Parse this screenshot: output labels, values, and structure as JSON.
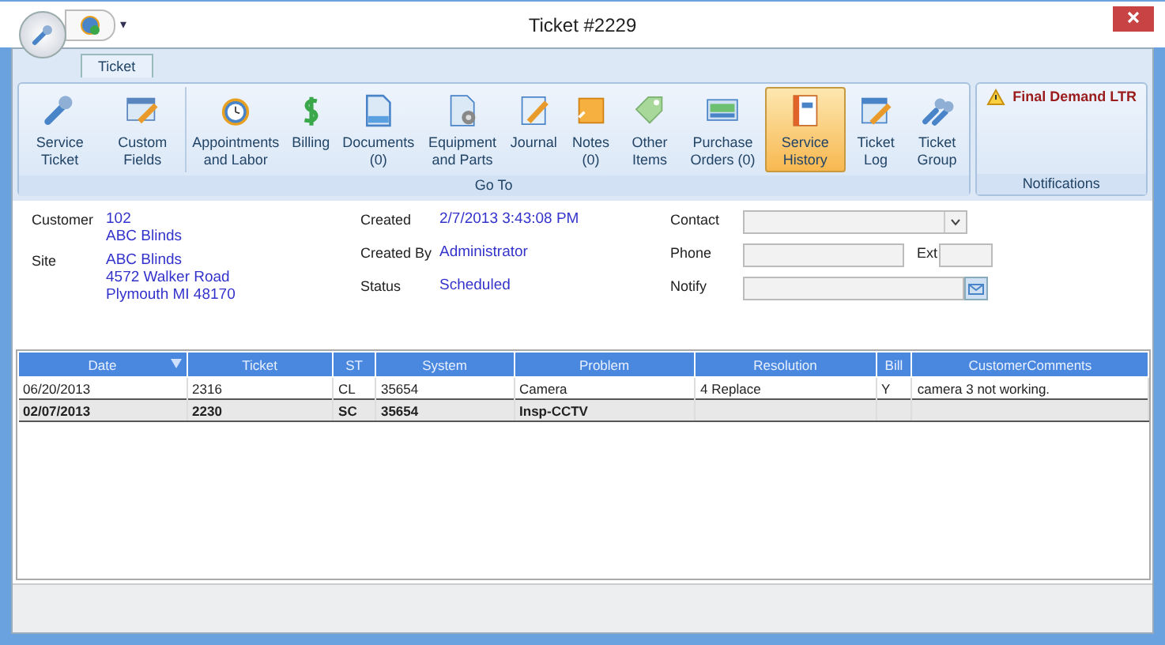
{
  "window": {
    "title": "Ticket #2229"
  },
  "quick_access": {
    "menu_glyph": "▾"
  },
  "tabs": [
    {
      "label": "Ticket",
      "selected": true
    }
  ],
  "ribbon": {
    "goto_group": {
      "label": "Go To",
      "sections": [
        [
          {
            "label": "Service Ticket",
            "selected": false
          },
          {
            "label": "Custom Fields",
            "selected": false
          }
        ],
        [
          {
            "label": "Appointments and Labor",
            "selected": false
          },
          {
            "label": "Billing",
            "selected": false
          },
          {
            "label": "Documents (0)",
            "selected": false
          },
          {
            "label": "Equipment and Parts",
            "selected": false
          },
          {
            "label": "Journal",
            "selected": false
          },
          {
            "label": "Notes (0)",
            "selected": false
          },
          {
            "label": "Other Items",
            "selected": false
          },
          {
            "label": "Purchase Orders (0)",
            "selected": false
          },
          {
            "label": "Service History",
            "selected": true
          },
          {
            "label": "Ticket Log",
            "selected": false
          },
          {
            "label": "Ticket Group",
            "selected": false
          }
        ]
      ]
    },
    "notifications": {
      "label": "Notifications",
      "items": [
        "Final Demand LTR"
      ]
    }
  },
  "details": {
    "customer": {
      "label": "Customer",
      "lines": [
        "102",
        "ABC Blinds"
      ]
    },
    "site": {
      "label": "Site",
      "lines": [
        "ABC Blinds",
        "4572 Walker Road",
        "Plymouth MI 48170"
      ]
    },
    "created": {
      "label": "Created",
      "value": "2/7/2013 3:43:08 PM"
    },
    "created_by": {
      "label": "Created By",
      "value": "Administrator"
    },
    "status": {
      "label": "Status",
      "value": "Scheduled"
    },
    "contact": {
      "label": "Contact"
    },
    "phone": {
      "label": "Phone"
    },
    "ext": {
      "label": "Ext"
    },
    "notify": {
      "label": "Notify"
    }
  },
  "table": {
    "columns": [
      "Date",
      "Ticket",
      "ST",
      "System",
      "Problem",
      "Resolution",
      "Bill",
      "CustomerComments"
    ],
    "rows": [
      {
        "selected": false,
        "cells": [
          "06/20/2013",
          "2316",
          "CL",
          "35654",
          "Camera",
          "4 Replace",
          "Y",
          "camera 3 not working."
        ]
      },
      {
        "selected": true,
        "cells": [
          "02/07/2013",
          "2230",
          "SC",
          "35654",
          "Insp-CCTV",
          "",
          "",
          ""
        ]
      }
    ]
  }
}
